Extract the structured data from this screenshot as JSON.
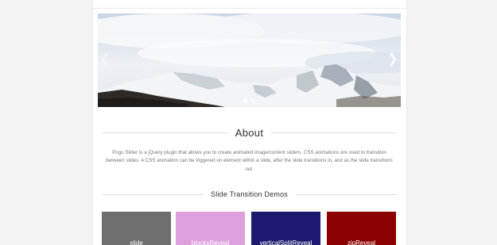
{
  "slider": {
    "prev_icon": "chevron-left-icon",
    "next_icon": "chevron-right-icon",
    "slide_count": 2,
    "active_slide": 1
  },
  "about": {
    "heading": "About",
    "body": "Pogo Slider is a jQuery plugin that allows you to create animated image/content sliders. CSS animations are used to transition between slides. A CSS animation can be triggered on element within a slide, after the slide transitions in, and as the slide transitions out."
  },
  "demos": {
    "heading": "Slide Transition Demos",
    "tiles": [
      {
        "label": "slide",
        "color": "#6e6e6e"
      },
      {
        "label": "blocksReveal",
        "color": "#dda0dd"
      },
      {
        "label": "verticalSplitReveal",
        "color": "#1c1a6e"
      },
      {
        "label": "zipReveal",
        "color": "#8b0000"
      }
    ]
  }
}
